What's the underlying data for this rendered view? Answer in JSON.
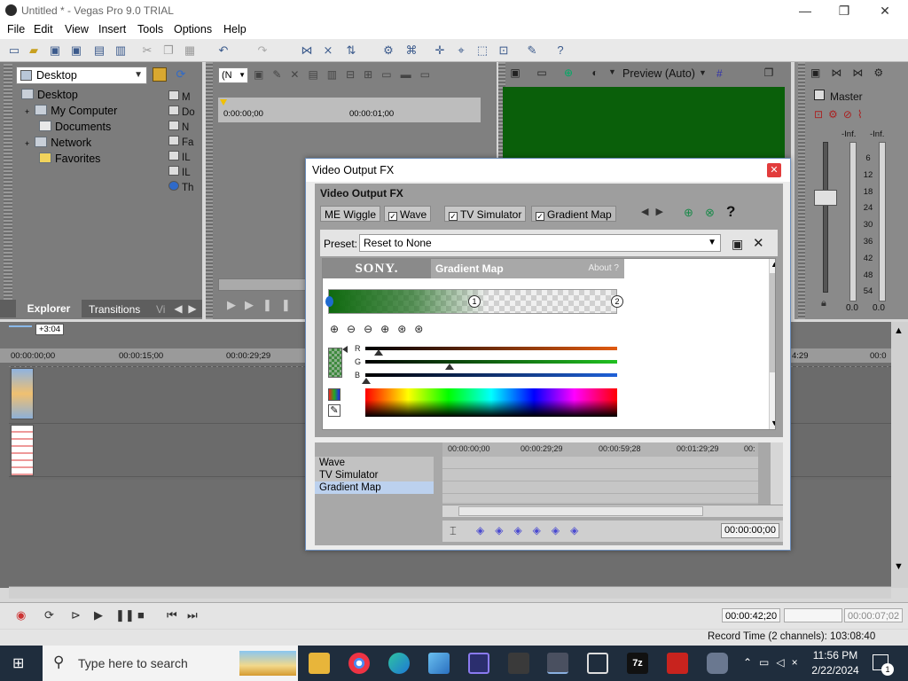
{
  "window": {
    "title": "Untitled * - Vegas Pro 9.0 TRIAL",
    "minimize": "—",
    "maximize": "❐",
    "close": "✕"
  },
  "menu": [
    "File",
    "Edit",
    "View",
    "Insert",
    "Tools",
    "Options",
    "Help"
  ],
  "explorer": {
    "location": "Desktop",
    "tree": [
      {
        "label": "Desktop",
        "expander": ""
      },
      {
        "label": "My Computer",
        "expander": "+"
      },
      {
        "label": "Documents",
        "expander": ""
      },
      {
        "label": "Network",
        "expander": "+"
      },
      {
        "label": "Favorites",
        "expander": ""
      }
    ],
    "file_list": [
      "M",
      "Do",
      "N",
      "Fa",
      "IL",
      "IL",
      "Th"
    ],
    "tabs": [
      "Explorer",
      "Transitions",
      "Vi"
    ]
  },
  "trimmer": {
    "combo": "(N",
    "times": [
      "0:00:00;00",
      "00:00:01;00"
    ]
  },
  "preview": {
    "label": "Preview (Auto)",
    "frame_color": "#0a5f0a"
  },
  "mixer": {
    "title": "Master",
    "left_label": "-Inf.",
    "right_label": "-Inf.",
    "scale": [
      "6",
      "12",
      "18",
      "24",
      "30",
      "36",
      "42",
      "48",
      "54"
    ],
    "left_value": "0.0",
    "right_value": "0.0"
  },
  "dialog": {
    "title": "Video Output FX",
    "subtitle": "Video Output FX",
    "chain_tabs": [
      {
        "label": "ME Wiggle",
        "checked": false
      },
      {
        "label": "Wave",
        "checked": true
      },
      {
        "label": "TV Simulator",
        "checked": true
      },
      {
        "label": "Gradient Map",
        "checked": true
      }
    ],
    "preset_label": "Preset:",
    "preset_value": "Reset to None",
    "plugin": {
      "brand": "SONY.",
      "name": "Gradient Map",
      "about": "About  ?",
      "markers": [
        "1",
        "2"
      ],
      "channels": [
        "R",
        "G",
        "B"
      ]
    },
    "chain_list": [
      "Wave",
      "TV Simulator",
      "Gradient Map"
    ],
    "keyframe_times": [
      "00:00:00;00",
      "00:00:29;29",
      "00:00:59;28",
      "00:01:29;29",
      "00:"
    ],
    "timecode": "00:00:00;00"
  },
  "timeline": {
    "offset": "+3:04",
    "ticks": [
      "00:00:00;00",
      "00:00:15;00",
      "00:00:29;29",
      "4:29",
      "00:0"
    ]
  },
  "transport": {
    "time_left": "00:00:42;20",
    "time_right": "00:00:07;02",
    "record_time": "Record Time (2 channels): 103:08:40"
  },
  "taskbar": {
    "search_placeholder": "Type here to search",
    "clock_time": "11:56 PM",
    "clock_date": "2/22/2024",
    "notification_count": "1"
  }
}
